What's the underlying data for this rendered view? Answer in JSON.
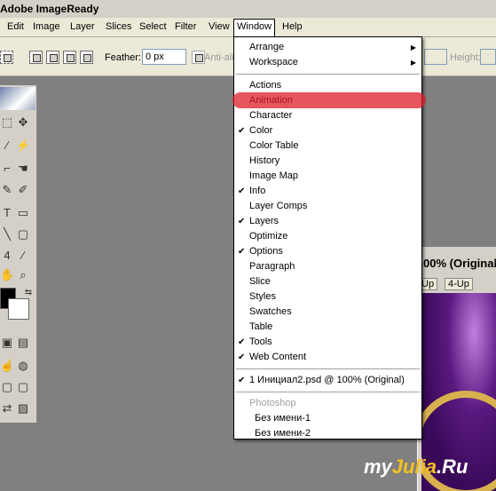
{
  "app_title": "Adobe ImageReady",
  "menubar": [
    "Edit",
    "Image",
    "Layer",
    "Slices",
    "Select",
    "Filter",
    "View",
    "Window",
    "Help"
  ],
  "options": {
    "feather_label": "Feather:",
    "feather_value": "0 px",
    "antialias_label": "Anti-ali",
    "height_label": "Height:"
  },
  "document": {
    "title": "00% (Original",
    "tabs": [
      "Up",
      "4-Up"
    ]
  },
  "window_menu": {
    "items": [
      {
        "label": "Arrange",
        "submenu": true
      },
      {
        "label": "Workspace",
        "submenu": true
      },
      {
        "sep": true
      },
      {
        "label": "Actions"
      },
      {
        "label": "Animation"
      },
      {
        "label": "Character"
      },
      {
        "label": "Color",
        "checked": true
      },
      {
        "label": "Color Table"
      },
      {
        "label": "History"
      },
      {
        "label": "Image Map"
      },
      {
        "label": "Info",
        "checked": true
      },
      {
        "label": "Layer Comps"
      },
      {
        "label": "Layers",
        "checked": true
      },
      {
        "label": "Optimize"
      },
      {
        "label": "Options",
        "checked": true
      },
      {
        "label": "Paragraph"
      },
      {
        "label": "Slice"
      },
      {
        "label": "Styles"
      },
      {
        "label": "Swatches"
      },
      {
        "label": "Table"
      },
      {
        "label": "Tools",
        "checked": true
      },
      {
        "label": "Web Content",
        "checked": true
      },
      {
        "sep": true
      },
      {
        "label": "1 Инициал2.psd @ 100% (Original)",
        "checked": true
      },
      {
        "sep": true
      },
      {
        "label": "Photoshop",
        "disabled": true
      },
      {
        "label": "Без имени-1",
        "indent": true
      },
      {
        "label": "Без имени-2",
        "indent": true
      }
    ]
  },
  "watermark": {
    "part1": "my",
    "part2": "Julia",
    "part3": ".Ru"
  },
  "colors": {
    "highlight": "#dc1e28",
    "menu_bg": "#ffffff",
    "workspace": "#808080"
  }
}
